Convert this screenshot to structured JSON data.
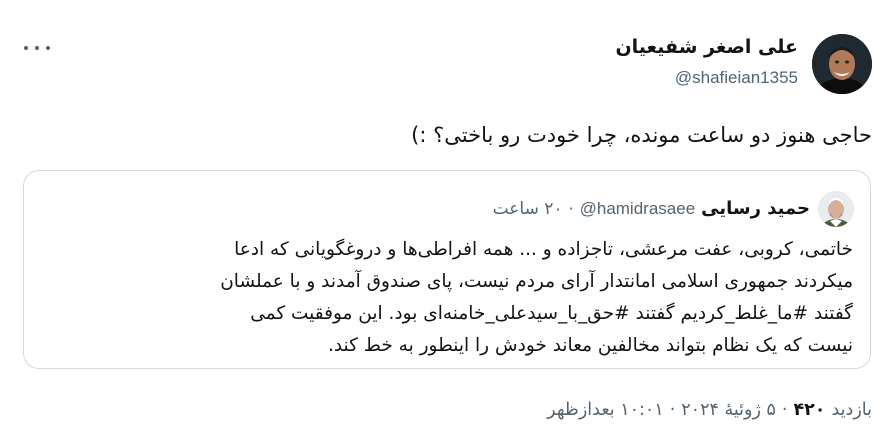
{
  "author": {
    "name": "علی اصغر شفیعیان",
    "handle": "@shafieian1355"
  },
  "tweet": {
    "text": "حاجی هنوز دو ساعت مونده، چرا خودت رو باختی؟ :)"
  },
  "quoted": {
    "name": "حمید رسایی",
    "handle": "@hamidrasaee",
    "separator": "·",
    "time": "۲۰ ساعت",
    "lines": [
      "خاتمی، کروبی، عفت مرعشی، تاجزاده و ... همه افراطی‌ها و دروغگویانی که ادعا",
      "میکردند جمهوری اسلامی امانتدار آرای مردم نیست، پای صندوق آمدند و با عملشان",
      "گفتند #ما_غلط_کردیم گفتند #حق_با_سیدعلی_خامنه‌ای بود. این موفقیت کمی",
      "نیست که یک نظام بتواند مخالفین معاند خودش را اینطور به خط کند."
    ]
  },
  "meta": {
    "time": "۱۰:۰۱ بعدازظهر",
    "sep1": "·",
    "date": "۵ ژوئیهٔ ۲۰۲۴",
    "sep2": "·",
    "views_count": "۴۲۰",
    "views_label": "بازدید"
  },
  "icons": {
    "more": "more-horizontal-icon"
  },
  "colors": {
    "text": "#0f1419",
    "secondary": "#536471",
    "border": "#cfd9de"
  }
}
